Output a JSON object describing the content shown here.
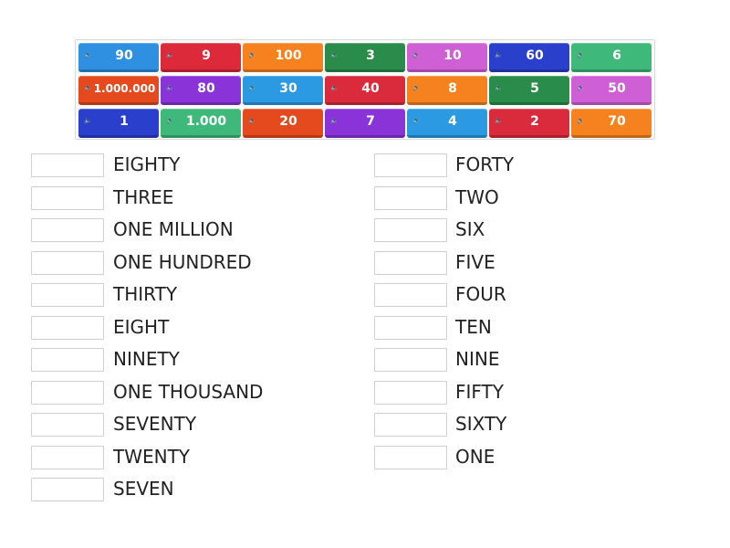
{
  "tiles": [
    {
      "label": "90",
      "color": "#2f8fe0"
    },
    {
      "label": "9",
      "color": "#dc2a3a"
    },
    {
      "label": "100",
      "color": "#f5821f"
    },
    {
      "label": "3",
      "color": "#2a8c4a"
    },
    {
      "label": "10",
      "color": "#cf5fd5"
    },
    {
      "label": "60",
      "color": "#2a3fcc"
    },
    {
      "label": "6",
      "color": "#3fb97a"
    },
    {
      "label": "1.000.000",
      "color": "#e44a1e"
    },
    {
      "label": "80",
      "color": "#8a33d9"
    },
    {
      "label": "30",
      "color": "#2b9ae3"
    },
    {
      "label": "40",
      "color": "#d92b3b"
    },
    {
      "label": "8",
      "color": "#f5821f"
    },
    {
      "label": "5",
      "color": "#2a8c4a"
    },
    {
      "label": "50",
      "color": "#cf5fd5"
    },
    {
      "label": "1",
      "color": "#2a3fcc"
    },
    {
      "label": "1.000",
      "color": "#3fb97a"
    },
    {
      "label": "20",
      "color": "#e44a1e"
    },
    {
      "label": "7",
      "color": "#8a33d9"
    },
    {
      "label": "4",
      "color": "#2b9ae3"
    },
    {
      "label": "2",
      "color": "#d92b3b"
    },
    {
      "label": "70",
      "color": "#f5821f"
    }
  ],
  "speaker_icon": "🔈",
  "left_words": [
    "EIGHTY",
    "THREE",
    "ONE MILLION",
    "ONE HUNDRED",
    "THIRTY",
    "EIGHT",
    "NINETY",
    "ONE THOUSAND",
    "SEVENTY",
    "TWENTY",
    "SEVEN"
  ],
  "right_words": [
    "FORTY",
    "TWO",
    "SIX",
    "FIVE",
    "FOUR",
    "TEN",
    "NINE",
    "FIFTY",
    "SIXTY",
    "ONE"
  ]
}
